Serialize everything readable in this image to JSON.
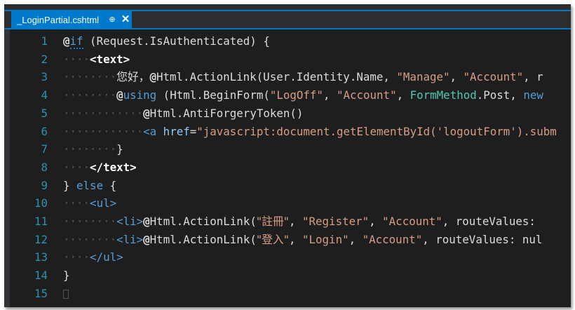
{
  "tab": {
    "title": "_LoginPartial.cshtml",
    "pin_glyph": "⊕",
    "close_glyph": "✕"
  },
  "colors": {
    "accent": "#007acc",
    "editor_bg": "#1e1e1e",
    "line_number": "#2b91af",
    "keyword": "#569cd6",
    "string": "#d69d85",
    "type": "#4ec9b0"
  },
  "lines": [
    {
      "num": "1",
      "ws": "",
      "tokens": [
        {
          "t": "@",
          "c": "c-razor"
        },
        {
          "t": "if",
          "c": "c-kw squig"
        },
        {
          "t": " (Request.IsAuthenticated) {",
          "c": "c-text"
        }
      ]
    },
    {
      "num": "2",
      "ws": "····",
      "tokens": [
        {
          "t": "<text>",
          "c": "c-bold"
        }
      ]
    },
    {
      "num": "3",
      "ws": "········",
      "tokens": [
        {
          "t": "您好，",
          "c": "c-text c-cjk"
        },
        {
          "t": "@",
          "c": "c-razor"
        },
        {
          "t": "Html.ActionLink(User.Identity.Name, ",
          "c": "c-text"
        },
        {
          "t": "\"Manage\"",
          "c": "c-str"
        },
        {
          "t": ", ",
          "c": "c-text"
        },
        {
          "t": "\"Account\"",
          "c": "c-str"
        },
        {
          "t": ", r",
          "c": "c-text"
        }
      ]
    },
    {
      "num": "4",
      "ws": "········",
      "tokens": [
        {
          "t": "@",
          "c": "c-razor"
        },
        {
          "t": "using",
          "c": "c-kw"
        },
        {
          "t": " (Html.BeginForm(",
          "c": "c-text"
        },
        {
          "t": "\"LogOff\"",
          "c": "c-str"
        },
        {
          "t": ", ",
          "c": "c-text"
        },
        {
          "t": "\"Account\"",
          "c": "c-str"
        },
        {
          "t": ", ",
          "c": "c-text"
        },
        {
          "t": "FormMethod",
          "c": "c-type"
        },
        {
          "t": ".Post, ",
          "c": "c-text"
        },
        {
          "t": "new",
          "c": "c-kw"
        }
      ]
    },
    {
      "num": "5",
      "ws": "············",
      "tokens": [
        {
          "t": "@",
          "c": "c-razor"
        },
        {
          "t": "Html.AntiForgeryToken()",
          "c": "c-text"
        }
      ]
    },
    {
      "num": "6",
      "ws": "············",
      "tokens": [
        {
          "t": "<",
          "c": "c-tag"
        },
        {
          "t": "a",
          "c": "c-tag"
        },
        {
          "t": " href",
          "c": "c-attr"
        },
        {
          "t": "=",
          "c": "c-text"
        },
        {
          "t": "\"javascript:document.getElementById('logoutForm').subm",
          "c": "c-str"
        }
      ]
    },
    {
      "num": "7",
      "ws": "········",
      "tokens": [
        {
          "t": "}",
          "c": "c-text"
        }
      ]
    },
    {
      "num": "8",
      "ws": "····",
      "tokens": [
        {
          "t": "</text>",
          "c": "c-bold"
        }
      ]
    },
    {
      "num": "9",
      "ws": "",
      "tokens": [
        {
          "t": "} ",
          "c": "c-text"
        },
        {
          "t": "else",
          "c": "c-kw"
        },
        {
          "t": " {",
          "c": "c-text"
        }
      ]
    },
    {
      "num": "10",
      "ws": "····",
      "tokens": [
        {
          "t": "<",
          "c": "c-tag"
        },
        {
          "t": "ul",
          "c": "c-tag"
        },
        {
          "t": ">",
          "c": "c-tag"
        }
      ]
    },
    {
      "num": "11",
      "ws": "········",
      "tokens": [
        {
          "t": "<",
          "c": "c-tag"
        },
        {
          "t": "li",
          "c": "c-tag"
        },
        {
          "t": ">",
          "c": "c-tag"
        },
        {
          "t": "@",
          "c": "c-razor"
        },
        {
          "t": "Html.ActionLink(",
          "c": "c-text"
        },
        {
          "t": "\"註冊\"",
          "c": "c-str c-cjk"
        },
        {
          "t": ", ",
          "c": "c-text"
        },
        {
          "t": "\"Register\"",
          "c": "c-str"
        },
        {
          "t": ", ",
          "c": "c-text"
        },
        {
          "t": "\"Account\"",
          "c": "c-str"
        },
        {
          "t": ", routeValues: ",
          "c": "c-text"
        }
      ]
    },
    {
      "num": "12",
      "ws": "········",
      "tokens": [
        {
          "t": "<",
          "c": "c-tag"
        },
        {
          "t": "li",
          "c": "c-tag"
        },
        {
          "t": ">",
          "c": "c-tag"
        },
        {
          "t": "@",
          "c": "c-razor"
        },
        {
          "t": "Html.ActionLink(",
          "c": "c-text"
        },
        {
          "t": "\"登入\"",
          "c": "c-str c-cjk"
        },
        {
          "t": ", ",
          "c": "c-text"
        },
        {
          "t": "\"Login\"",
          "c": "c-str"
        },
        {
          "t": ", ",
          "c": "c-text"
        },
        {
          "t": "\"Account\"",
          "c": "c-str"
        },
        {
          "t": ", routeValues: nul",
          "c": "c-text"
        }
      ]
    },
    {
      "num": "13",
      "ws": "····",
      "tokens": [
        {
          "t": "</",
          "c": "c-tag"
        },
        {
          "t": "ul",
          "c": "c-tag"
        },
        {
          "t": ">",
          "c": "c-tag"
        }
      ]
    },
    {
      "num": "14",
      "ws": "",
      "tokens": [
        {
          "t": "}",
          "c": "c-text"
        }
      ]
    },
    {
      "num": "15",
      "ws": "",
      "tokens": []
    }
  ]
}
